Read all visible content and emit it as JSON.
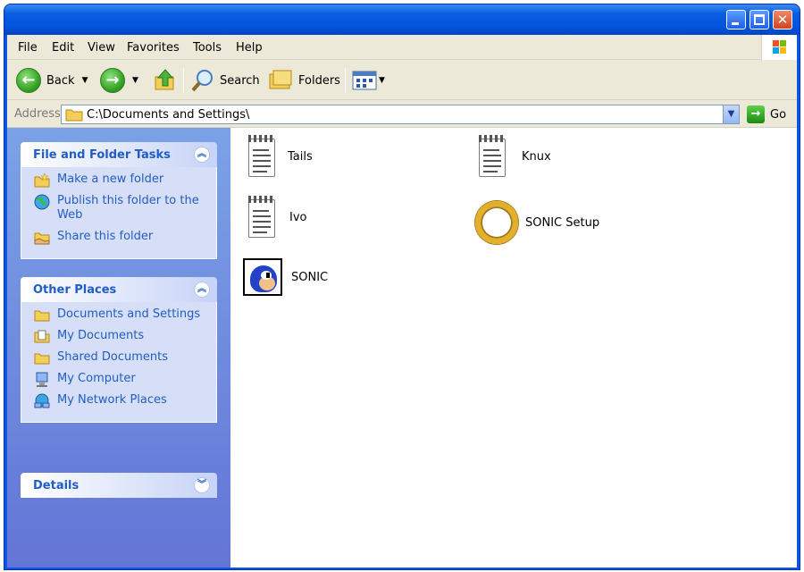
{
  "window": {
    "title": "",
    "controls": {
      "minimize": "minimize",
      "maximize": "maximize",
      "close": "close"
    }
  },
  "menu": [
    "File",
    "Edit",
    "View",
    "Favorites",
    "Tools",
    "Help"
  ],
  "toolbar": {
    "back": "Back",
    "search": "Search",
    "folders": "Folders"
  },
  "address": {
    "label": "Address",
    "value": "C:\\Documents and Settings\\",
    "go": "Go"
  },
  "sidebar": {
    "file_tasks": {
      "title": "File and Folder Tasks",
      "items": [
        {
          "label": "Make a new folder",
          "icon": "new-folder-icon"
        },
        {
          "label": "Publish this folder to the Web",
          "icon": "publish-web-icon"
        },
        {
          "label": "Share this folder",
          "icon": "share-folder-icon"
        }
      ]
    },
    "other_places": {
      "title": "Other Places",
      "items": [
        {
          "label": "Documents and Settings",
          "icon": "folder-icon"
        },
        {
          "label": "My Documents",
          "icon": "my-documents-icon"
        },
        {
          "label": "Shared Documents",
          "icon": "folder-icon"
        },
        {
          "label": "My Computer",
          "icon": "my-computer-icon"
        },
        {
          "label": "My Network Places",
          "icon": "network-places-icon"
        }
      ]
    },
    "details": {
      "title": "Details"
    }
  },
  "files": [
    {
      "name": "Tails",
      "icon": "notepad-icon"
    },
    {
      "name": "Knux",
      "icon": "notepad-icon"
    },
    {
      "name": "Ivo",
      "icon": "notepad-icon"
    },
    {
      "name": "SONIC Setup",
      "icon": "gold-ring-icon"
    },
    {
      "name": "SONIC",
      "icon": "sonic-icon"
    }
  ],
  "colors": {
    "titlebar": "#0554e0",
    "sidebar_top": "#7ba2e7",
    "sidebar_bottom": "#6375d6",
    "link": "#215dc6",
    "chrome": "#ece9d8"
  }
}
